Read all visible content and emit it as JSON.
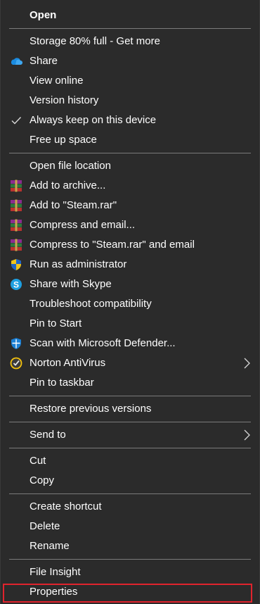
{
  "menu": {
    "open": "Open",
    "storage": "Storage 80% full - Get more",
    "share": "Share",
    "view_online": "View online",
    "version_history": "Version history",
    "always_keep": "Always keep on this device",
    "free_up": "Free up space",
    "open_location": "Open file location",
    "add_archive": "Add to archive...",
    "add_steam_rar": "Add to \"Steam.rar\"",
    "compress_email": "Compress and email...",
    "compress_steam_email": "Compress to \"Steam.rar\" and email",
    "run_admin": "Run as administrator",
    "share_skype": "Share with Skype",
    "troubleshoot": "Troubleshoot compatibility",
    "pin_start": "Pin to Start",
    "scan_defender": "Scan with Microsoft Defender...",
    "norton": "Norton AntiVirus",
    "pin_taskbar": "Pin to taskbar",
    "restore_versions": "Restore previous versions",
    "send_to": "Send to",
    "cut": "Cut",
    "copy": "Copy",
    "create_shortcut": "Create shortcut",
    "delete": "Delete",
    "rename": "Rename",
    "file_insight": "File Insight",
    "properties": "Properties"
  },
  "icons": {
    "share": "onedrive-cloud-icon",
    "always_keep": "checkmark-icon",
    "winrar": "winrar-books-icon",
    "run_admin": "uac-shield-icon",
    "skype": "skype-icon",
    "defender": "defender-shield-icon",
    "norton": "norton-check-icon",
    "submenu": "chevron-right-icon"
  },
  "colors": {
    "background": "#2b2b2b",
    "text": "#ffffff",
    "separator": "#7b7b7b",
    "highlight_border": "#e0232d"
  }
}
